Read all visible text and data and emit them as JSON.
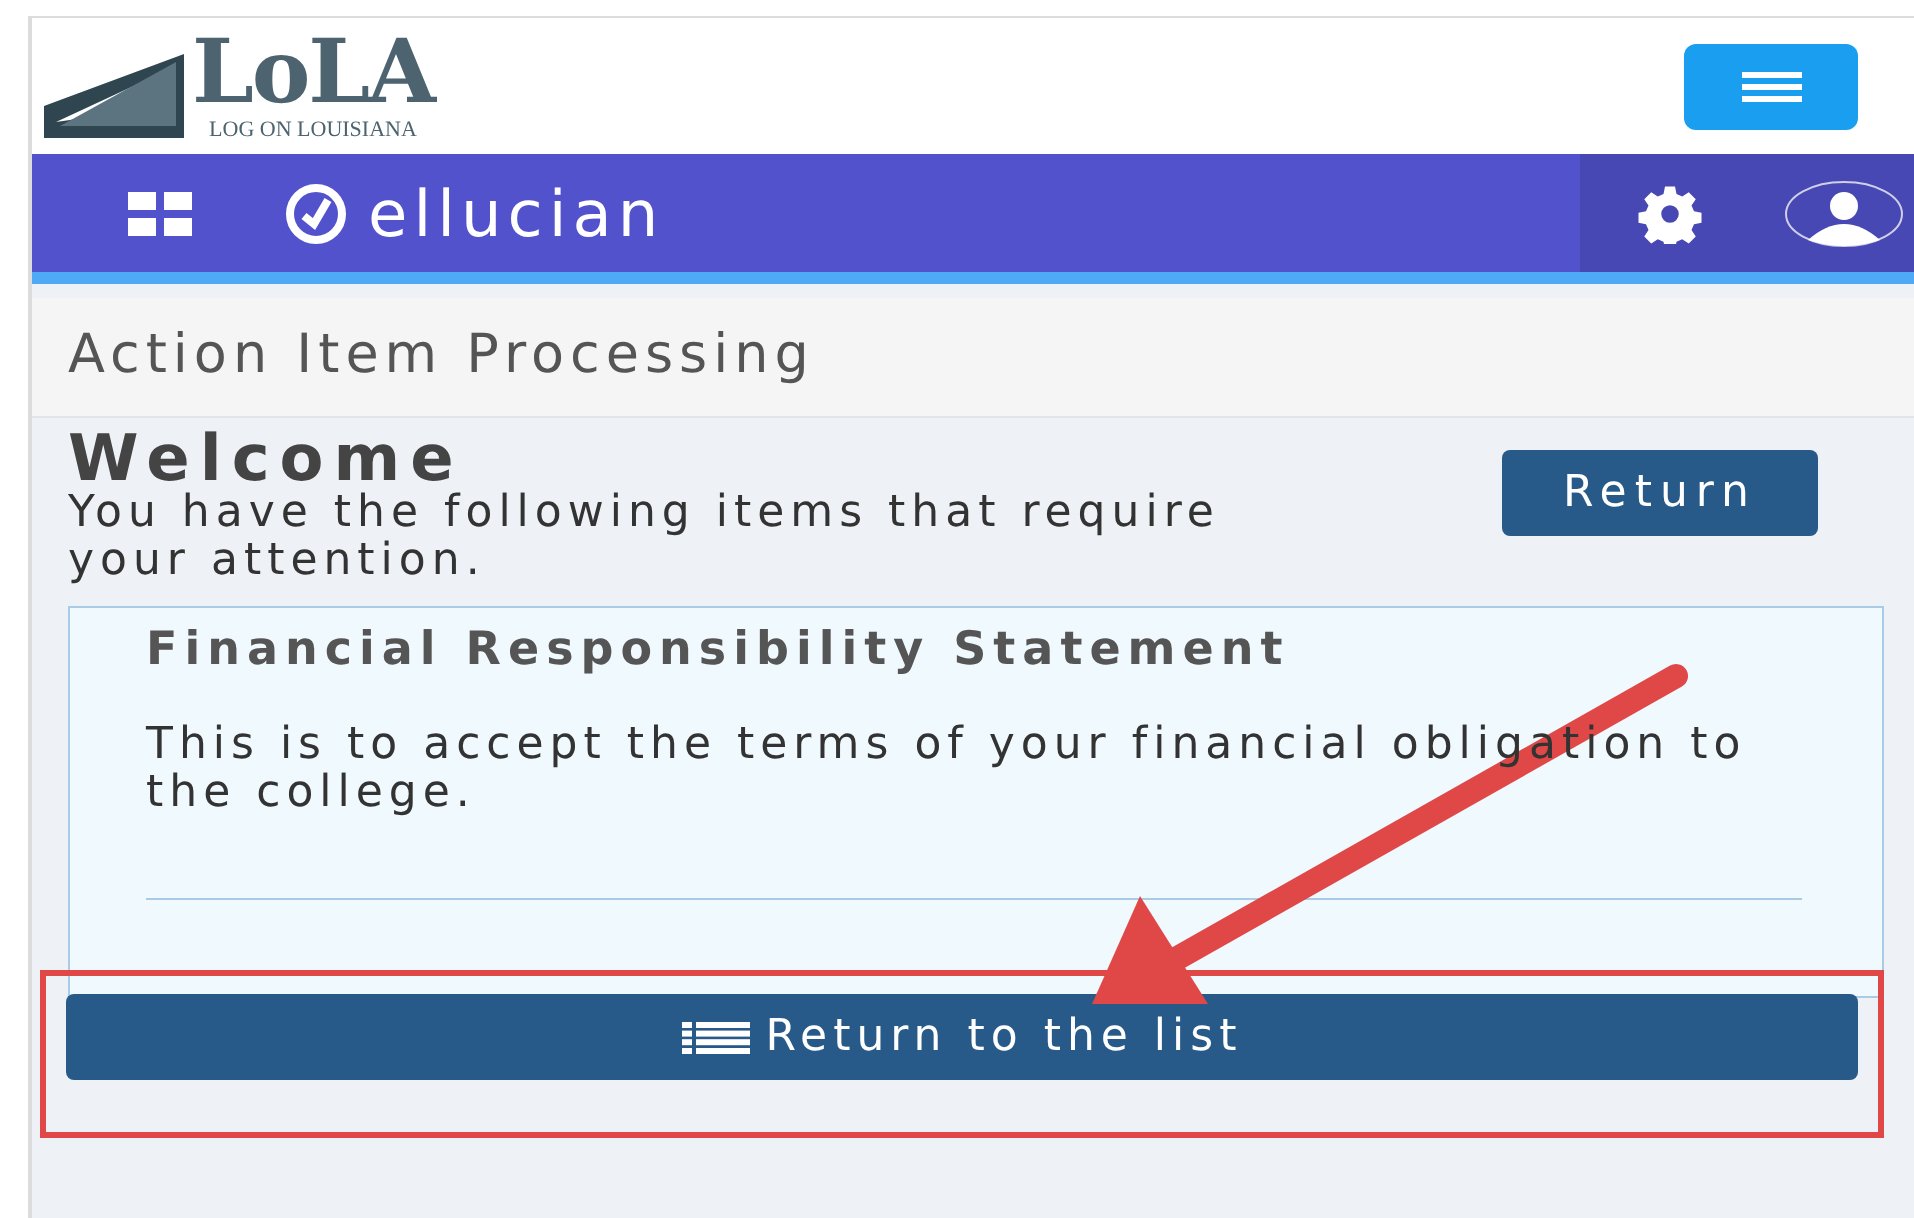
{
  "logo": {
    "wordmark": "LoLA",
    "tagline": "LOG ON LOUISIANA"
  },
  "nav": {
    "brand": "ellucian"
  },
  "page_title": "Action Item Processing",
  "welcome": {
    "heading": "Welcome",
    "message": "You have the following items that require your attention.",
    "return_button": "Return"
  },
  "item": {
    "title": "Financial Responsibility Statement",
    "description": "This is to accept the terms of your financial obligation to the college."
  },
  "list_button": "Return to the list"
}
